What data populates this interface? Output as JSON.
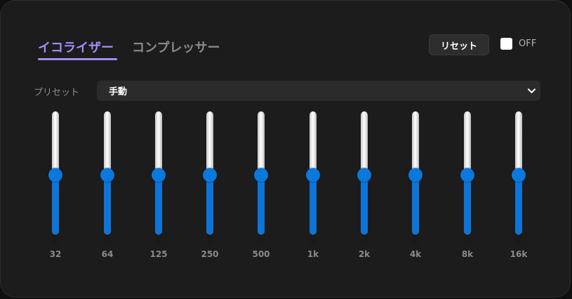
{
  "tabs": [
    {
      "label": "イコライザー",
      "active": true
    },
    {
      "label": "コンプレッサー",
      "active": false
    }
  ],
  "reset_label": "リセット",
  "toggle": {
    "label": "OFF",
    "checked": false
  },
  "preset": {
    "label": "プリセット",
    "value": "手動"
  },
  "colors": {
    "accent": "#a78bfa",
    "slider_fill": "#0d74d8",
    "thumb": "#0b78dc"
  },
  "bands": [
    {
      "label": "32",
      "level": 0
    },
    {
      "label": "64",
      "level": 0
    },
    {
      "label": "125",
      "level": 0
    },
    {
      "label": "250",
      "level": 0
    },
    {
      "label": "500",
      "level": 0
    },
    {
      "label": "1k",
      "level": 0
    },
    {
      "label": "2k",
      "level": 0
    },
    {
      "label": "4k",
      "level": 0
    },
    {
      "label": "8k",
      "level": 0
    },
    {
      "label": "16k",
      "level": 0
    }
  ],
  "level_range": [
    -12,
    12
  ]
}
